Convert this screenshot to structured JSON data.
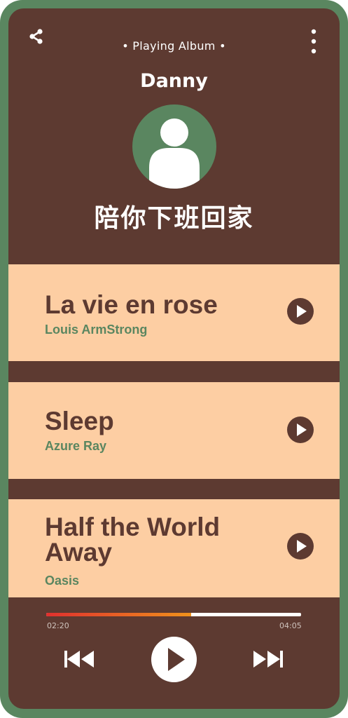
{
  "header": {
    "title": "• Playing Album •",
    "share_icon": "share-icon",
    "more_icon": "more-vertical-icon"
  },
  "artist": {
    "name": "Danny",
    "avatar_icon": "user-avatar-icon"
  },
  "album": {
    "title": "陪你下班回家"
  },
  "tracks": [
    {
      "title": "La vie en rose",
      "artist": "Louis ArmStrong",
      "play_icon": "play-icon"
    },
    {
      "title": "Sleep",
      "artist": "Azure Ray",
      "play_icon": "play-icon"
    },
    {
      "title": "Half the World Away",
      "artist": "Oasis",
      "play_icon": "play-icon"
    }
  ],
  "player": {
    "current_time": "02:20",
    "total_time": "04:05",
    "progress": 0.57,
    "prev_icon": "skip-previous-icon",
    "play_icon": "play-icon",
    "next_icon": "skip-next-icon"
  },
  "colors": {
    "background": "#5d3a31",
    "frame": "#5a8660",
    "card": "#fdcea3",
    "accent_green": "#5a8660",
    "progress_start": "#e0302e",
    "progress_end": "#f0921c"
  }
}
